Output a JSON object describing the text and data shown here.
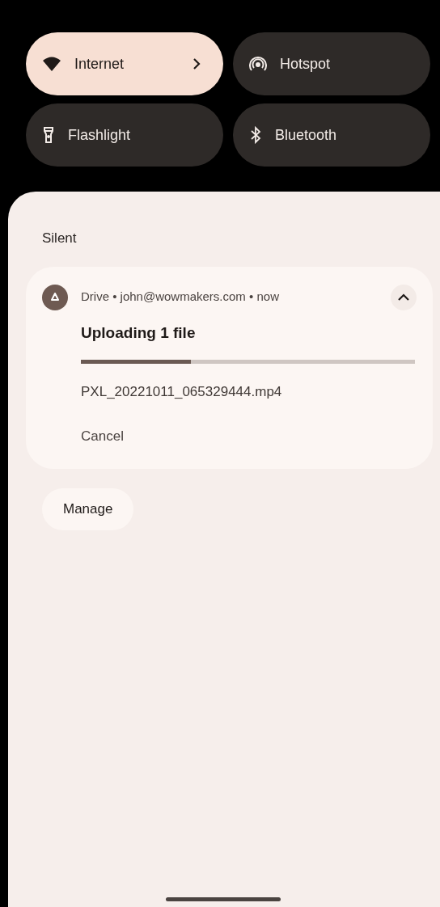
{
  "tiles": [
    {
      "kind": "wifi",
      "label": "Internet",
      "on": true,
      "has_details": true
    },
    {
      "kind": "hotspot",
      "label": "Hotspot",
      "on": false,
      "has_details": false
    },
    {
      "kind": "flashlight",
      "label": "Flashlight",
      "on": false,
      "has_details": false
    },
    {
      "kind": "bluetooth",
      "label": "Bluetooth",
      "on": false,
      "has_details": false
    }
  ],
  "section_title": "Silent",
  "notification": {
    "header": "Drive • john@wowmakers.com • now",
    "expanded": true,
    "title": "Uploading 1 file",
    "progress": {
      "level": 0.33
    },
    "file": "PXL_20221011_065329444.mp4",
    "action": "Cancel"
  },
  "manage_button": "Manage"
}
